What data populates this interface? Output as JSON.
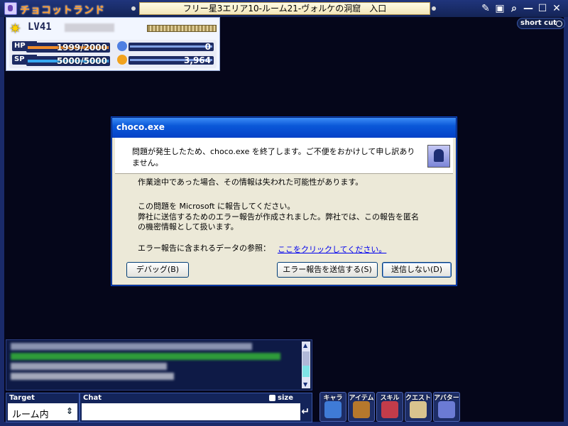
{
  "app": {
    "logo": "チョコットランド",
    "room_title": "フリー星3エリア10-ルーム21-ヴォルケの洞窟　入口",
    "controls": [
      "✎",
      "▣",
      "⌕",
      "—",
      "☐",
      "✕"
    ],
    "shortcut_label": "short cut"
  },
  "status": {
    "level": "LV41",
    "hp_label": "HP",
    "hp_text": "1999/2000",
    "hp_fraction": 0.9995,
    "sp_label": "SP",
    "sp_text": "5000/5000",
    "sp_fraction": 1.0,
    "points": "0",
    "money": "3,964"
  },
  "dialog": {
    "title": "choco.exe",
    "header_text": "問題が発生したため、choco.exe を終了します。ご不便をおかけして申し訳ありません。",
    "line1": "作業途中であった場合、その情報は失われた可能性があります。",
    "line2": "この問題を Microsoft に報告してください。",
    "line3": "弊社に送信するためのエラー報告が作成されました。弊社では、この報告を匿名の機密情報として扱います。",
    "data_ref_label": "エラー報告に含まれるデータの参照：",
    "link_text": "ここをクリックしてください。",
    "debug_button": "デバッグ(B)",
    "send_button": "エラー報告を送信する(S)",
    "dont_send_button": "送信しない(D)"
  },
  "chat": {
    "target_label": "Target",
    "target_value": "ルーム内",
    "chat_label": "Chat",
    "size_label": "size"
  },
  "menu": [
    {
      "label": "キャラ",
      "color": "#3f7bd6"
    },
    {
      "label": "アイテム",
      "color": "#b6782c"
    },
    {
      "label": "スキル",
      "color": "#c23c4a"
    },
    {
      "label": "クエスト",
      "color": "#d8c38e"
    },
    {
      "label": "アバター",
      "color": "#6b7bd4"
    }
  ],
  "colors": {
    "hp_fill": "#f08b2a",
    "sp_fill": "#36a8f0",
    "coin_blue": "#4f7fe2",
    "coin_gold": "#f1a21d"
  }
}
